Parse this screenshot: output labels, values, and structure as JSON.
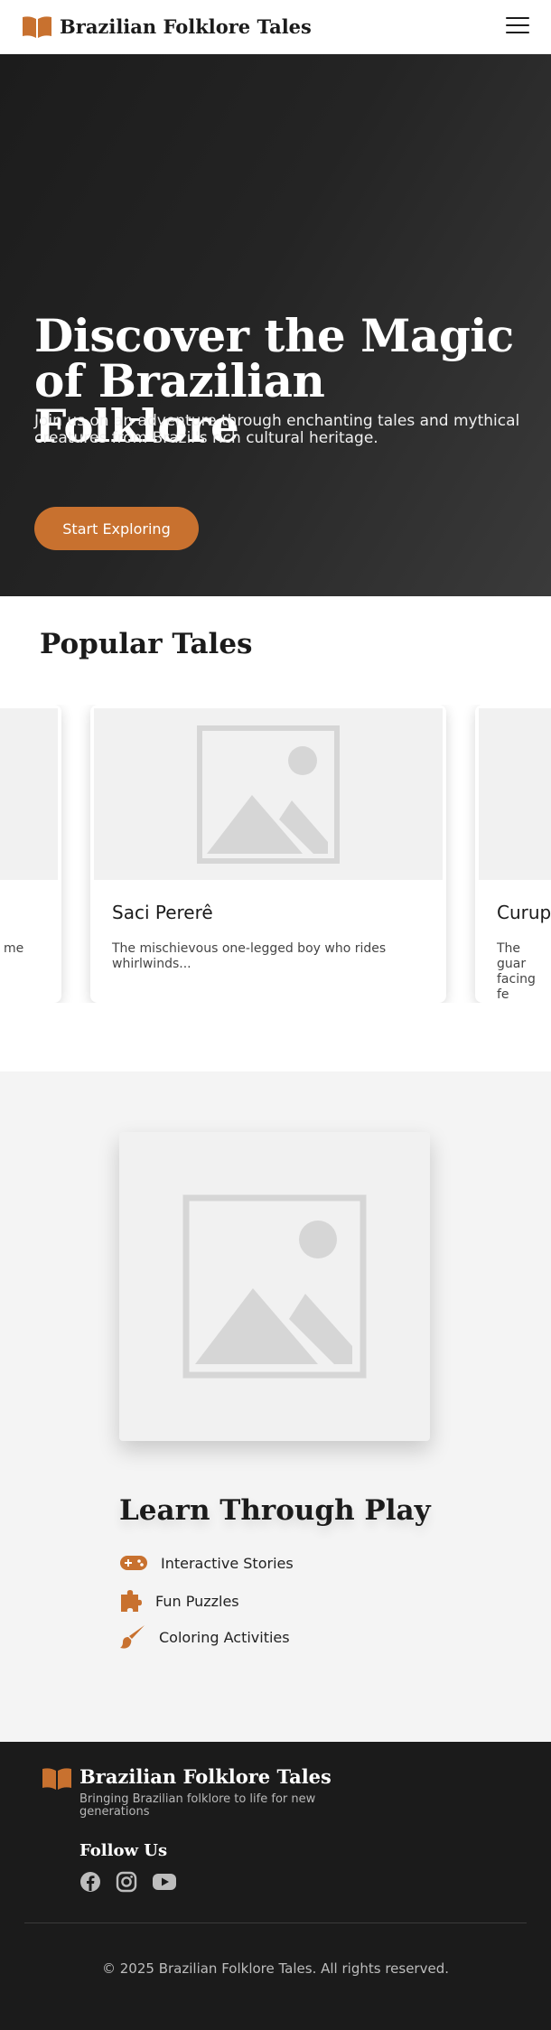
{
  "header": {
    "brand": "Brazilian Folklore Tales",
    "logo_icon": "open-book-icon",
    "menu_icon": "hamburger-menu-icon"
  },
  "hero": {
    "title": "Discover the Magic of Brazilian Folklore",
    "subtitle": "Join us on an adventure through enchanting tales and mythical creatures from Brazil's rich cultural heritage.",
    "cta_label": "Start Exploring"
  },
  "popular": {
    "title": "Popular Tales",
    "cards": [
      {
        "title": "",
        "desc": "me"
      },
      {
        "title": "Saci Pererê",
        "desc": "The mischievous one-legged boy who rides whirlwinds..."
      },
      {
        "title": "Curupi",
        "desc": "The guar facing fe"
      }
    ]
  },
  "play": {
    "title": "Learn Through Play",
    "features": [
      {
        "label": "Interactive Stories",
        "icon": "gamepad-icon"
      },
      {
        "label": "Fun Puzzles",
        "icon": "puzzle-piece-icon"
      },
      {
        "label": "Coloring Activities",
        "icon": "paintbrush-icon"
      }
    ]
  },
  "footer": {
    "brand": "Brazilian Folklore Tales",
    "tagline": "Bringing Brazilian folklore to life for new generations",
    "follow_title": "Follow Us",
    "social": [
      "facebook-icon",
      "instagram-icon",
      "youtube-icon"
    ],
    "copyright": "© 2025 Brazilian Folklore Tales. All rights reserved."
  },
  "colors": {
    "accent": "#c8712f",
    "dark": "#1b1b1b",
    "light_bg": "#f4f4f4"
  }
}
